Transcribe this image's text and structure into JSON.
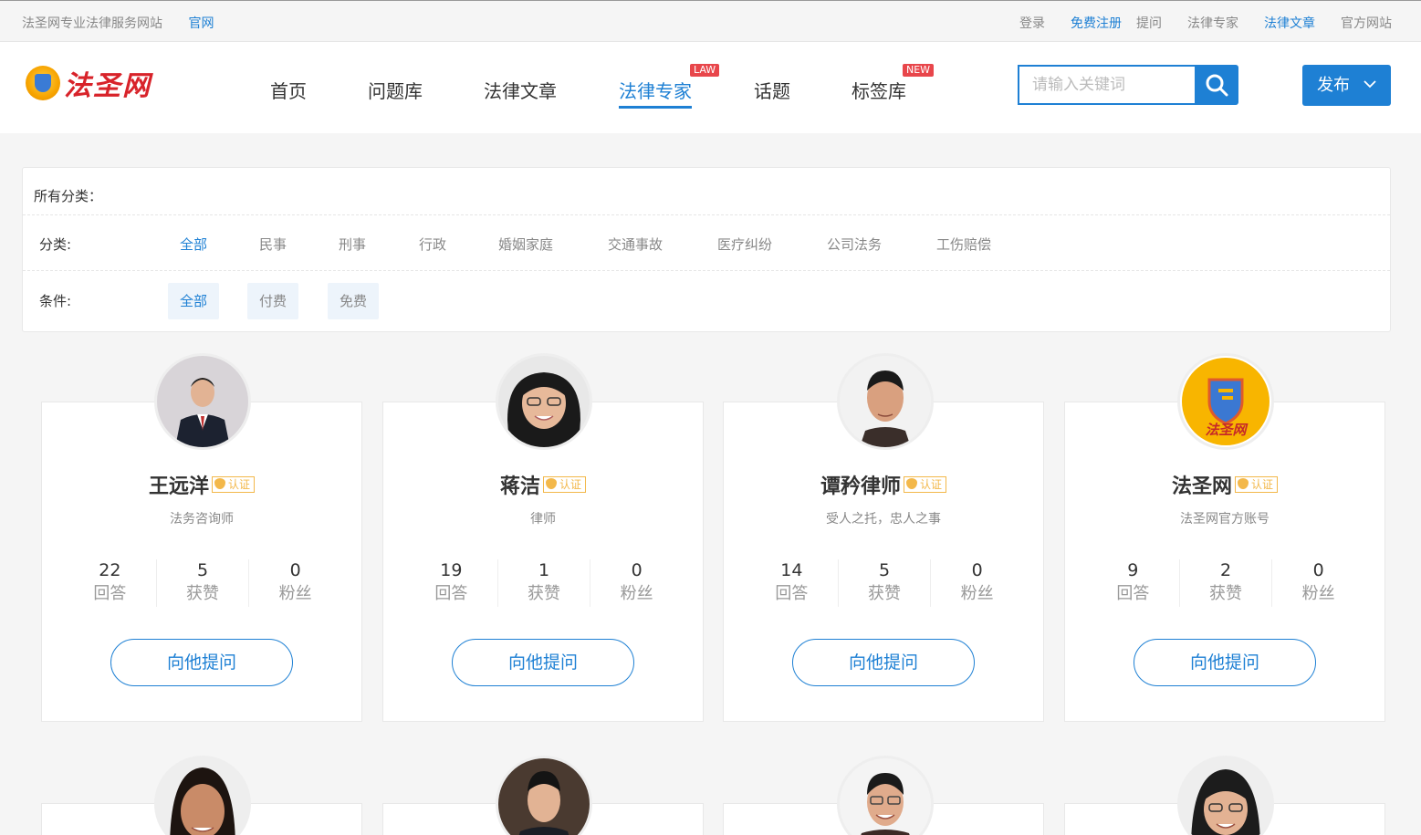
{
  "topbar": {
    "site_name": "法圣网专业法律服务网站",
    "official": "官网",
    "links": [
      "登录",
      "免费注册",
      "提问",
      "法律专家",
      "法律文章",
      "官方网站"
    ]
  },
  "header": {
    "brand": "法圣网",
    "nav": [
      {
        "label": "首页",
        "tag": ""
      },
      {
        "label": "问题库",
        "tag": ""
      },
      {
        "label": "法律文章",
        "tag": ""
      },
      {
        "label": "法律专家",
        "tag": "LAW"
      },
      {
        "label": "话题",
        "tag": ""
      },
      {
        "label": "标签库",
        "tag": "NEW"
      }
    ],
    "search_placeholder": "请输入关键词",
    "publish_label": "发布"
  },
  "filter": {
    "all_label": "所有分类：",
    "category_label": "分类:",
    "categories": [
      "全部",
      "民事",
      "刑事",
      "行政",
      "婚姻家庭",
      "交通事故",
      "医疗纠纷",
      "公司法务",
      "工伤赔偿"
    ],
    "condition_label": "条件:",
    "conditions": [
      "全部",
      "付费",
      "免费"
    ]
  },
  "badge_label": "认证",
  "stat_labels": {
    "answers": "回答",
    "likes": "获赞",
    "fans": "粉丝"
  },
  "ask_label": "向他提问",
  "experts": [
    {
      "name": "王远洋",
      "title": "法务咨询师",
      "answers": "22",
      "likes": "5",
      "fans": "0"
    },
    {
      "name": "蒋洁",
      "title": "律师",
      "answers": "19",
      "likes": "1",
      "fans": "0"
    },
    {
      "name": "谭矜律师",
      "title": "受人之托，忠人之事",
      "answers": "14",
      "likes": "5",
      "fans": "0"
    },
    {
      "name": "法圣网",
      "title": "法圣网官方账号",
      "answers": "9",
      "likes": "2",
      "fans": "0"
    }
  ],
  "logo_avatar_text": "法圣网",
  "colors": {
    "accent": "#1e80d4",
    "tag_red": "#e8464b",
    "badge_gold": "#f3b84a",
    "brand_red": "#d8232a"
  }
}
